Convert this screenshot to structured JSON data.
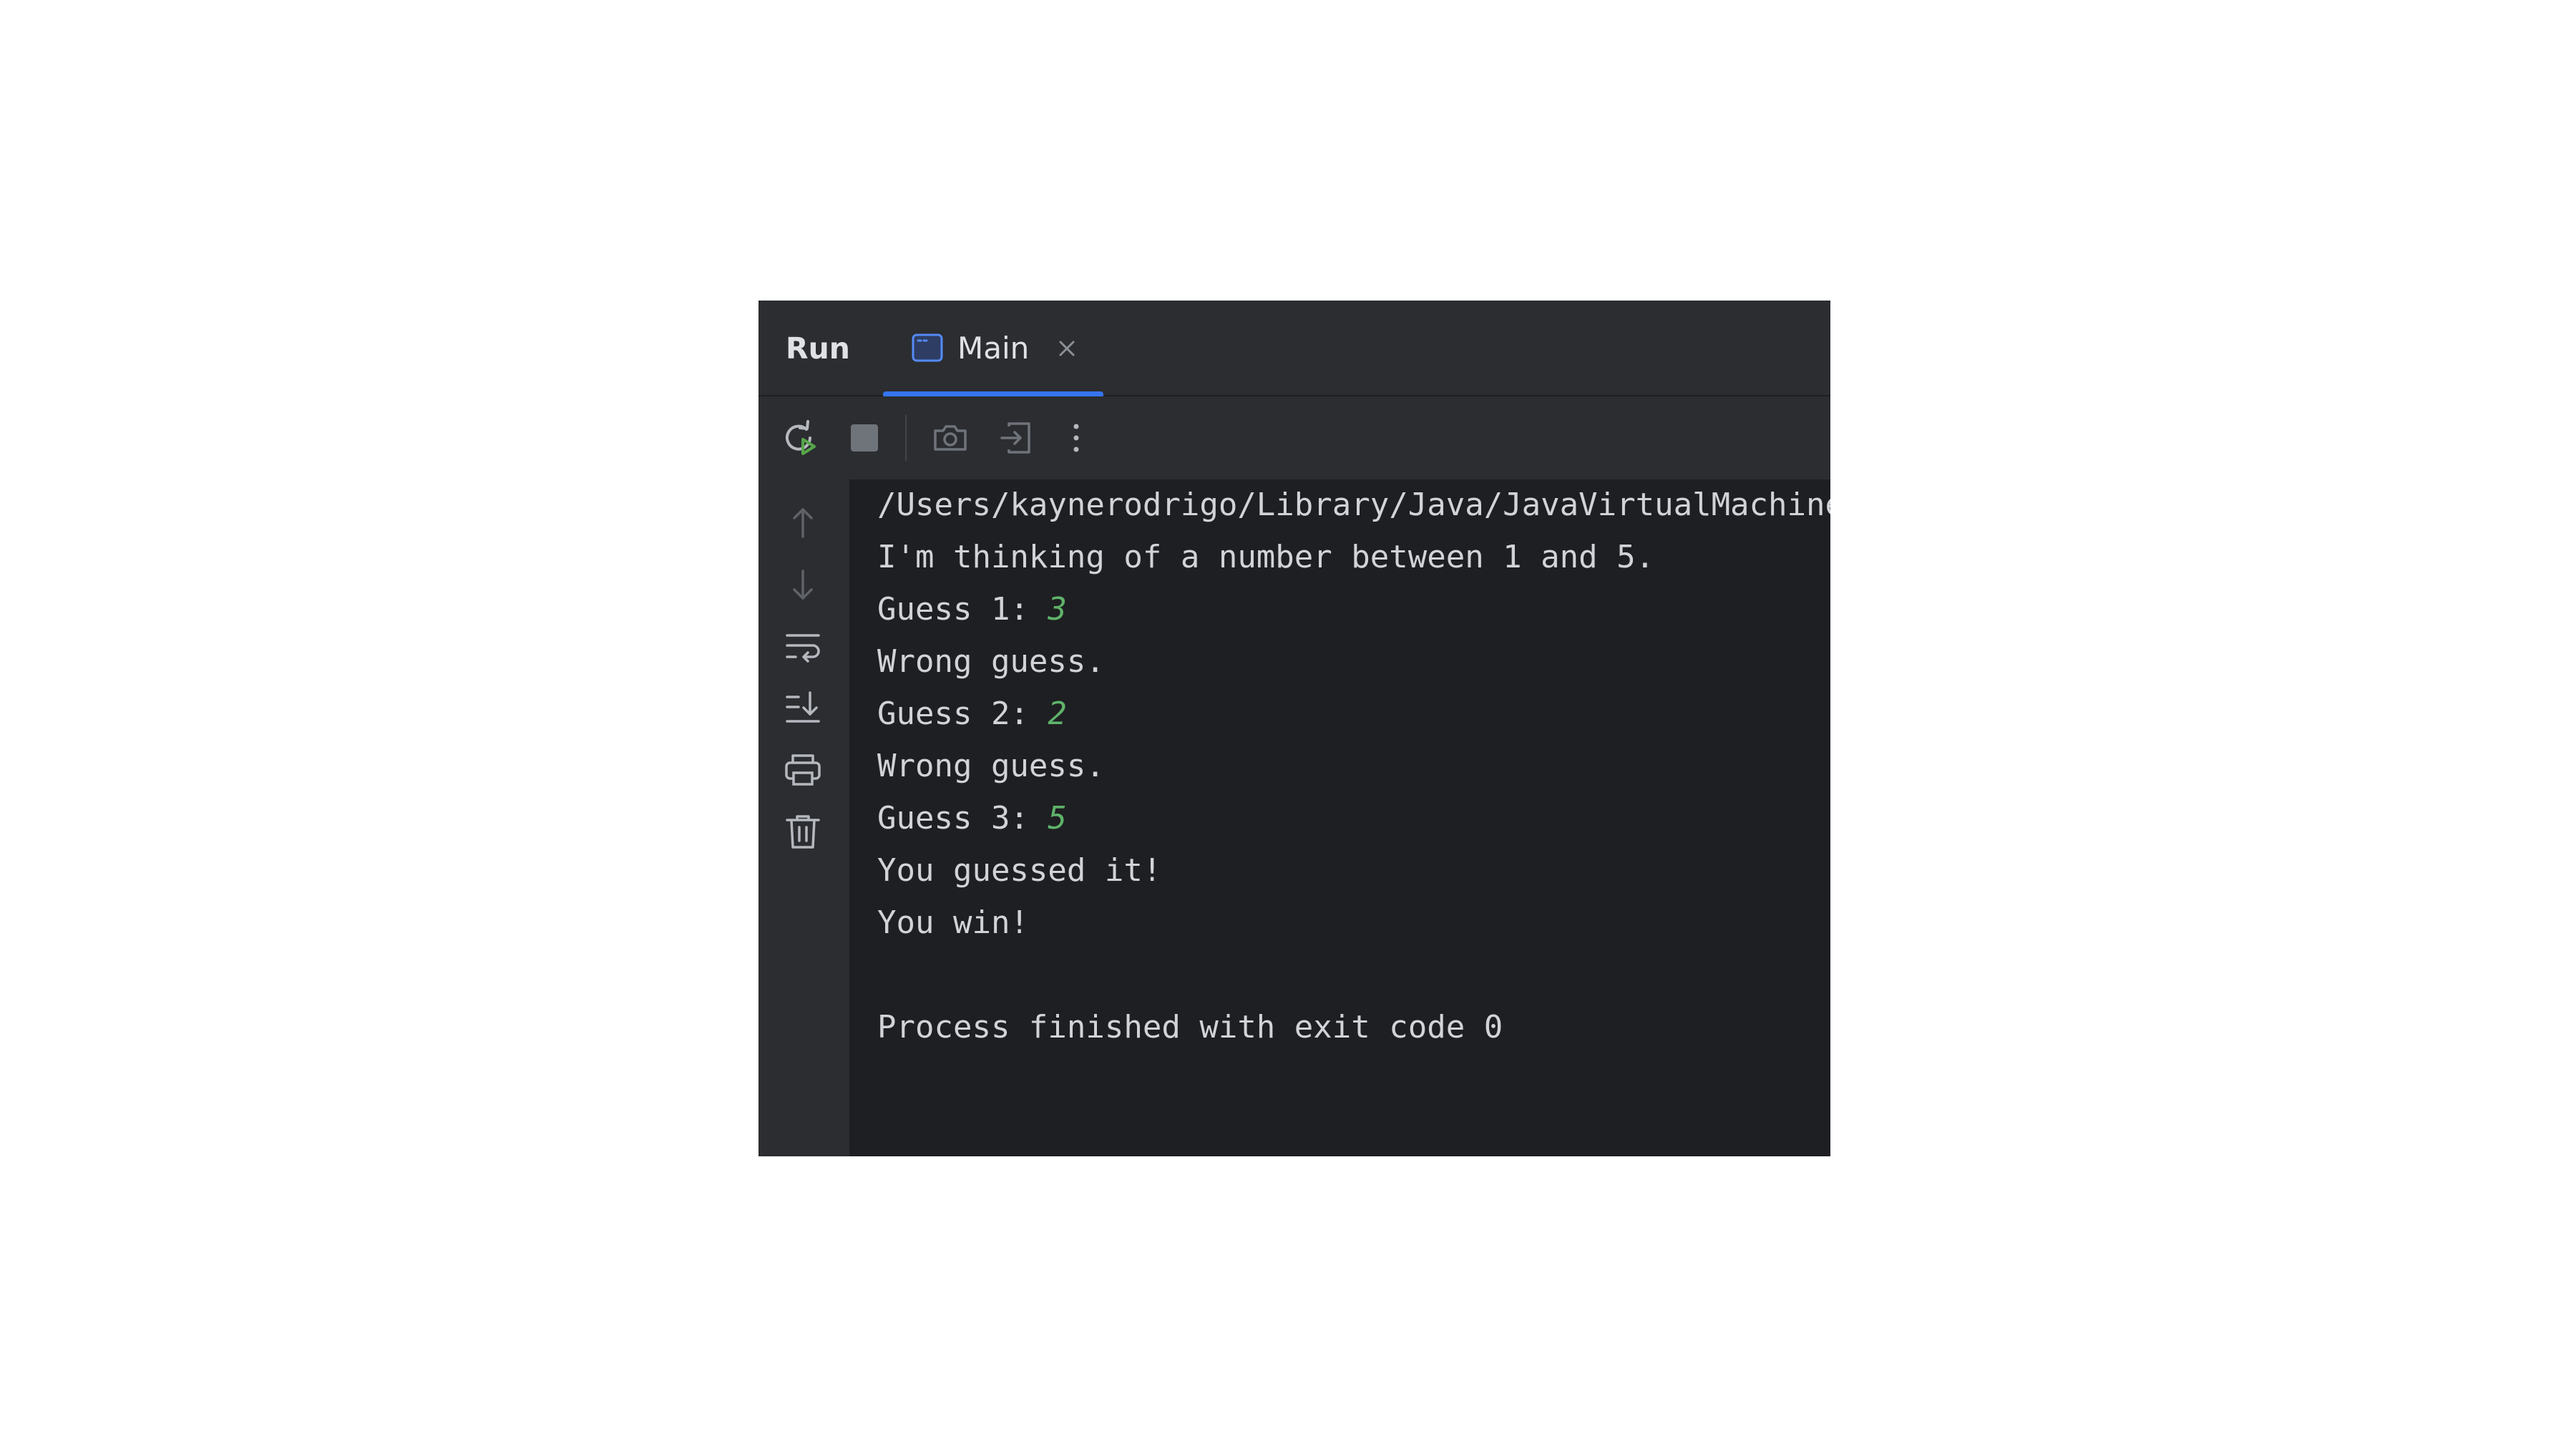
{
  "tool_window": {
    "title": "Run",
    "tab": {
      "label": "Main",
      "icon": "application-window-icon"
    }
  },
  "toolbar": {
    "buttons": [
      {
        "name": "rerun-button",
        "icon": "rerun-icon"
      },
      {
        "name": "stop-button",
        "icon": "stop-icon"
      },
      {
        "name": "screenshot-button",
        "icon": "camera-icon"
      },
      {
        "name": "exit-button",
        "icon": "sign-in-icon"
      },
      {
        "name": "more-options-button",
        "icon": "vertical-ellipsis-icon"
      }
    ]
  },
  "gutter": {
    "buttons": [
      {
        "name": "scroll-up-button",
        "icon": "arrow-up-icon"
      },
      {
        "name": "scroll-down-button",
        "icon": "arrow-down-icon"
      },
      {
        "name": "soft-wrap-button",
        "icon": "soft-wrap-icon"
      },
      {
        "name": "scroll-to-end-button",
        "icon": "scroll-to-end-icon"
      },
      {
        "name": "print-button",
        "icon": "printer-icon"
      },
      {
        "name": "clear-all-button",
        "icon": "trash-icon"
      }
    ]
  },
  "console": {
    "lines": [
      {
        "text": "/Users/kaynerodrigo/Library/Java/JavaVirtualMachines"
      },
      {
        "text": "I'm thinking of a number between 1 and 5."
      },
      {
        "prefix": "Guess 1: ",
        "input": "3"
      },
      {
        "text": "Wrong guess."
      },
      {
        "prefix": "Guess 2: ",
        "input": "2"
      },
      {
        "text": "Wrong guess."
      },
      {
        "prefix": "Guess 3: ",
        "input": "5"
      },
      {
        "text": "You guessed it!"
      },
      {
        "text": "You win!"
      },
      {
        "text": ""
      },
      {
        "text": "Process finished with exit code 0"
      }
    ]
  },
  "colors": {
    "accent": "#3574f0",
    "input_green": "#5fb36a",
    "panel": "#2b2d30",
    "console_bg": "#1e1f22",
    "text": "#d1d3d8"
  }
}
